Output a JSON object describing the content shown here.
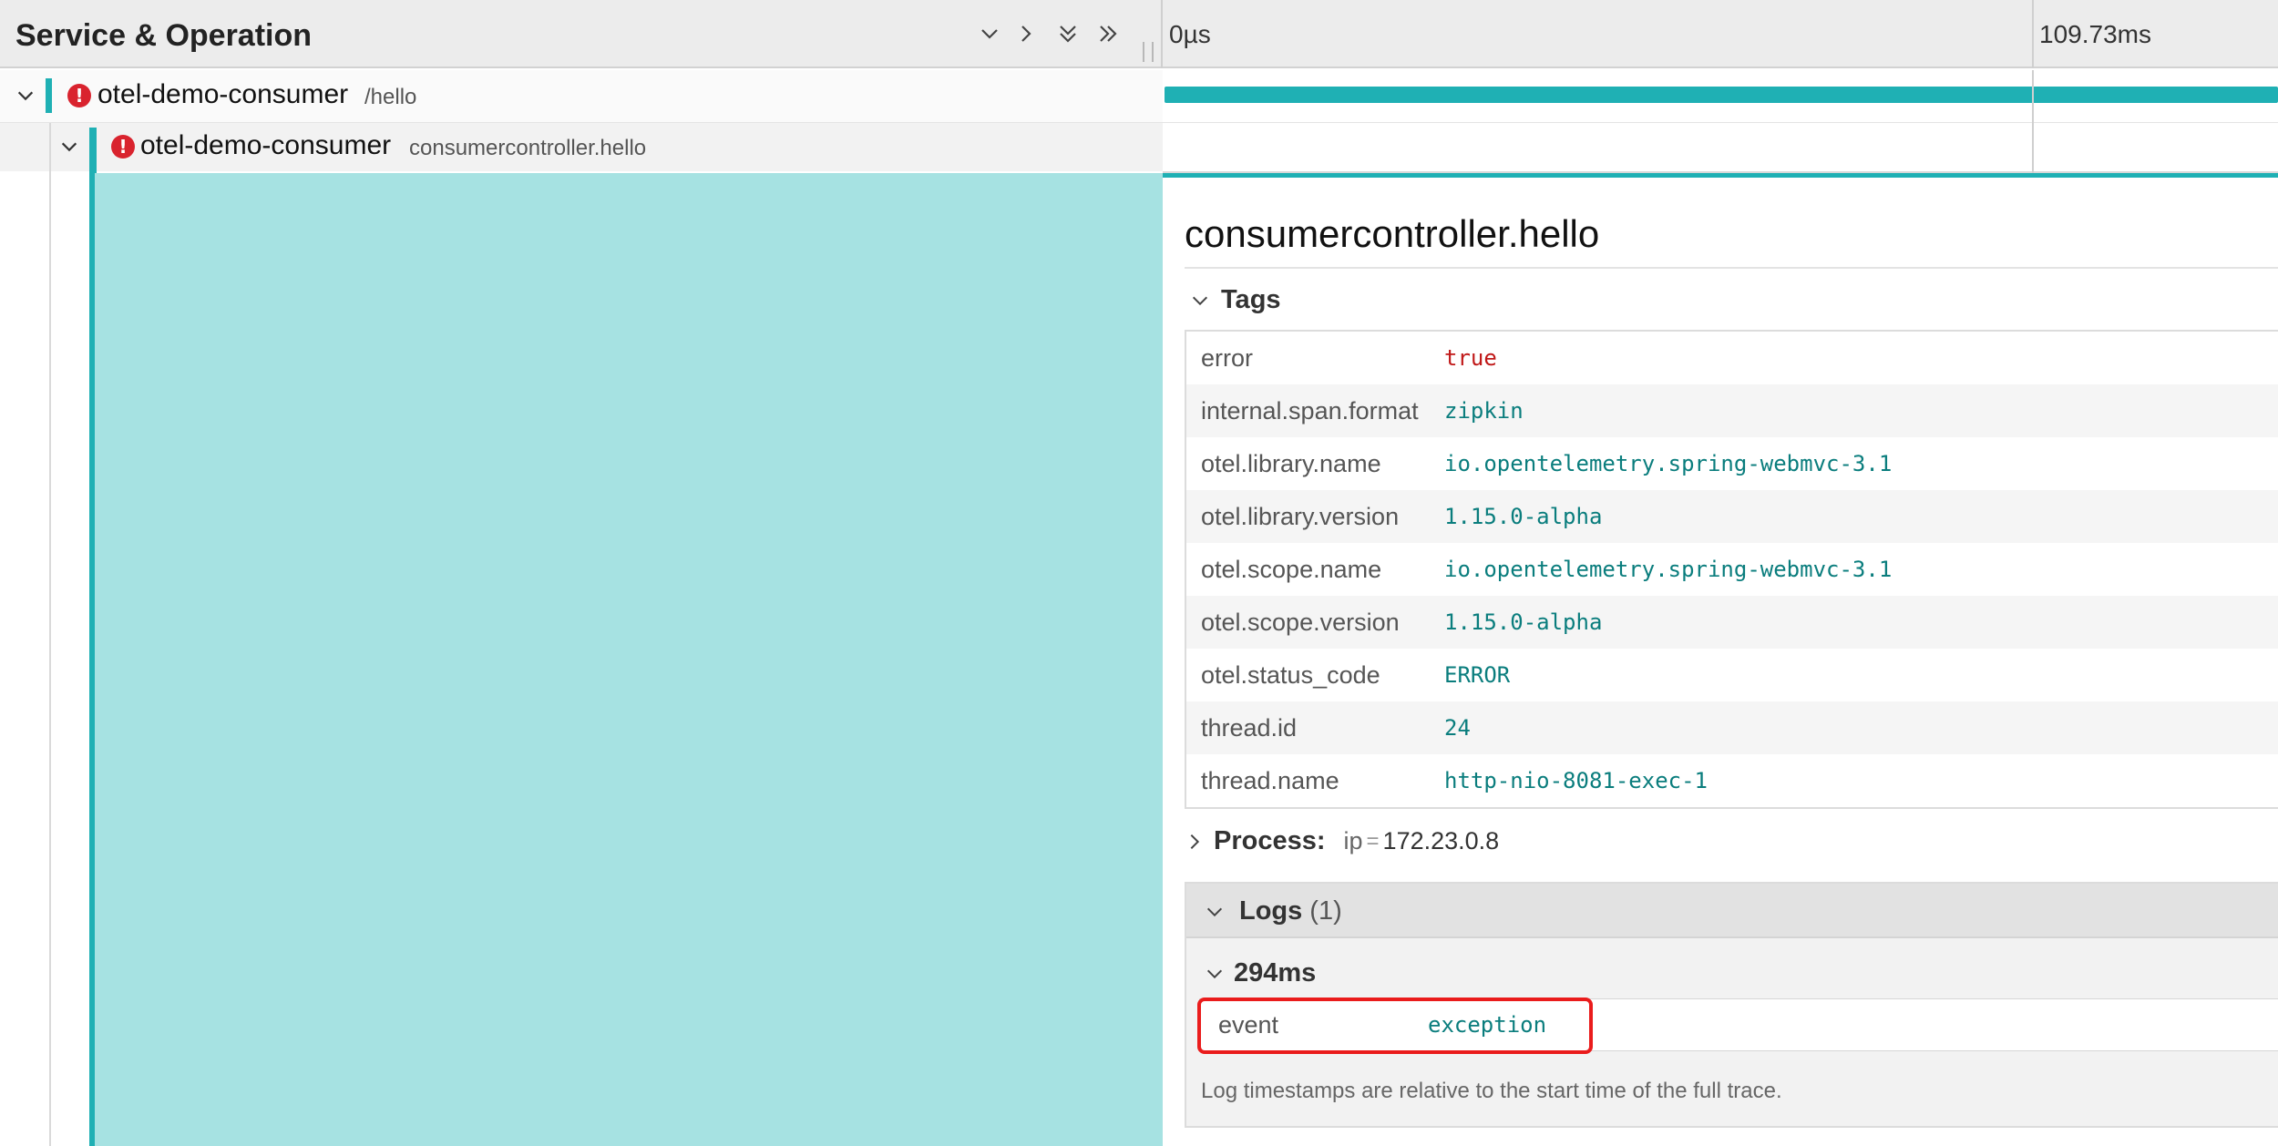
{
  "header": {
    "title": "Service & Operation",
    "ticks": [
      "0µs",
      "109.73ms"
    ]
  },
  "trace": {
    "rows": [
      {
        "service": "otel-demo-consumer",
        "operation": "/hello",
        "error": true
      },
      {
        "service": "otel-demo-consumer",
        "operation": "consumercontroller.hello",
        "error": true
      }
    ]
  },
  "detail": {
    "title": "consumercontroller.hello",
    "tags_label": "Tags",
    "tags": [
      {
        "key": "error",
        "value": "true"
      },
      {
        "key": "internal.span.format",
        "value": "zipkin"
      },
      {
        "key": "otel.library.name",
        "value": "io.opentelemetry.spring-webmvc-3.1"
      },
      {
        "key": "otel.library.version",
        "value": "1.15.0-alpha"
      },
      {
        "key": "otel.scope.name",
        "value": "io.opentelemetry.spring-webmvc-3.1"
      },
      {
        "key": "otel.scope.version",
        "value": "1.15.0-alpha"
      },
      {
        "key": "otel.status_code",
        "value": "ERROR"
      },
      {
        "key": "thread.id",
        "value": "24"
      },
      {
        "key": "thread.name",
        "value": "http-nio-8081-exec-1"
      }
    ],
    "process": {
      "label": "Process:",
      "key": "ip",
      "eq": "=",
      "value": "172.23.0.8"
    },
    "logs": {
      "label": "Logs",
      "count": "(1)",
      "entry_time": "294ms",
      "entry_key": "event",
      "entry_value": "exception",
      "note": "Log timestamps are relative to the start time of the full trace."
    }
  },
  "colors": {
    "accent": "#1fb0b4",
    "span_fill": "#a6e2e2",
    "error": "#d9232e",
    "highlight": "#ea1c1c",
    "tag_value": "#0a7d7d"
  },
  "icons": [
    "chevron-down-icon",
    "chevron-right-icon",
    "double-chevron-down-icon",
    "double-chevron-right-icon",
    "error-icon"
  ]
}
